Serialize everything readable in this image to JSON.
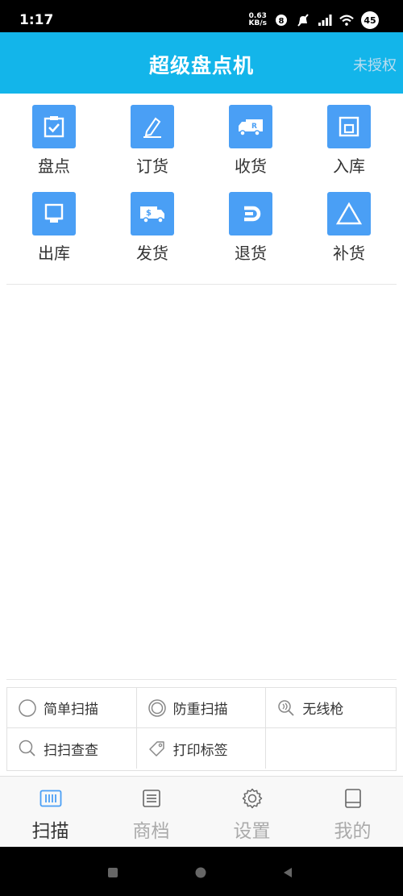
{
  "status_bar": {
    "time": "1:17",
    "net_speed_value": "0.63",
    "net_speed_unit": "KB/s",
    "battery": "45"
  },
  "header": {
    "title": "超级盘点机",
    "auth_status": "未授权"
  },
  "functions": [
    {
      "label": "盘点",
      "icon": "clipboard-check-icon"
    },
    {
      "label": "订货",
      "icon": "pen-icon"
    },
    {
      "label": "收货",
      "icon": "delivery-van-icon"
    },
    {
      "label": "入库",
      "icon": "warehouse-in-icon"
    },
    {
      "label": "出库",
      "icon": "warehouse-out-icon"
    },
    {
      "label": "发货",
      "icon": "shipping-truck-icon"
    },
    {
      "label": "退货",
      "icon": "return-arrow-icon"
    },
    {
      "label": "补货",
      "icon": "triangle-icon"
    }
  ],
  "options": [
    {
      "label": "简单扫描",
      "icon": "radio-empty-icon"
    },
    {
      "label": "防重扫描",
      "icon": "radio-ring-icon"
    },
    {
      "label": "无线枪",
      "icon": "wireless-scanner-icon"
    },
    {
      "label": "扫扫查查",
      "icon": "search-icon"
    },
    {
      "label": "打印标签",
      "icon": "tag-icon"
    }
  ],
  "bottom_nav": [
    {
      "label": "扫描",
      "icon": "barcode-scan-icon",
      "active": true
    },
    {
      "label": "商档",
      "icon": "document-list-icon",
      "active": false
    },
    {
      "label": "设置",
      "icon": "gear-icon",
      "active": false
    },
    {
      "label": "我的",
      "icon": "book-icon",
      "active": false
    }
  ],
  "colors": {
    "header_bg": "#13b5ea",
    "icon_bg": "#4a9ff5",
    "nav_active": "#333333",
    "nav_inactive": "#aaaaaa"
  }
}
